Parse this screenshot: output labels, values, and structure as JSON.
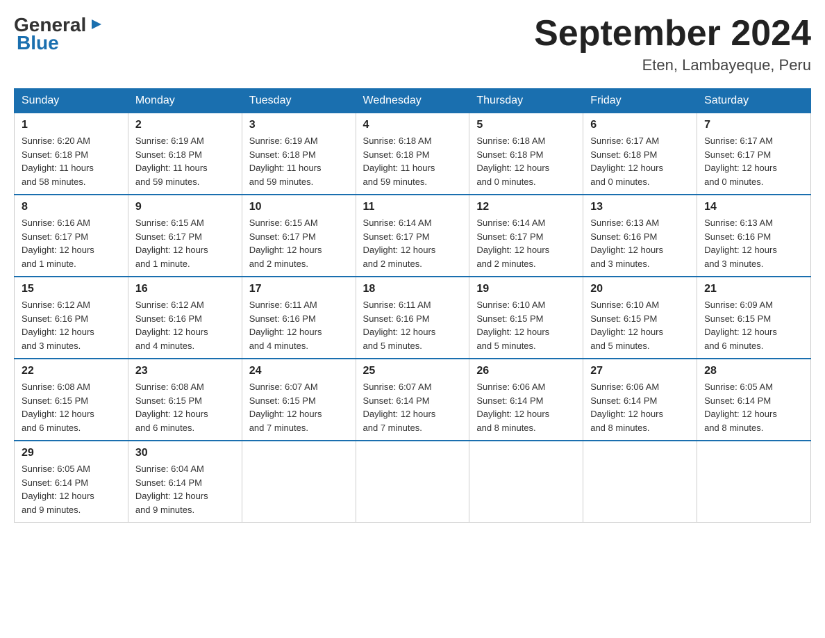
{
  "header": {
    "logo_general": "General",
    "logo_blue": "Blue",
    "month_year": "September 2024",
    "location": "Eten, Lambayeque, Peru"
  },
  "days_of_week": [
    "Sunday",
    "Monday",
    "Tuesday",
    "Wednesday",
    "Thursday",
    "Friday",
    "Saturday"
  ],
  "weeks": [
    [
      {
        "day": "1",
        "sunrise": "6:20 AM",
        "sunset": "6:18 PM",
        "daylight": "11 hours and 58 minutes."
      },
      {
        "day": "2",
        "sunrise": "6:19 AM",
        "sunset": "6:18 PM",
        "daylight": "11 hours and 59 minutes."
      },
      {
        "day": "3",
        "sunrise": "6:19 AM",
        "sunset": "6:18 PM",
        "daylight": "11 hours and 59 minutes."
      },
      {
        "day": "4",
        "sunrise": "6:18 AM",
        "sunset": "6:18 PM",
        "daylight": "11 hours and 59 minutes."
      },
      {
        "day": "5",
        "sunrise": "6:18 AM",
        "sunset": "6:18 PM",
        "daylight": "12 hours and 0 minutes."
      },
      {
        "day": "6",
        "sunrise": "6:17 AM",
        "sunset": "6:18 PM",
        "daylight": "12 hours and 0 minutes."
      },
      {
        "day": "7",
        "sunrise": "6:17 AM",
        "sunset": "6:17 PM",
        "daylight": "12 hours and 0 minutes."
      }
    ],
    [
      {
        "day": "8",
        "sunrise": "6:16 AM",
        "sunset": "6:17 PM",
        "daylight": "12 hours and 1 minute."
      },
      {
        "day": "9",
        "sunrise": "6:15 AM",
        "sunset": "6:17 PM",
        "daylight": "12 hours and 1 minute."
      },
      {
        "day": "10",
        "sunrise": "6:15 AM",
        "sunset": "6:17 PM",
        "daylight": "12 hours and 2 minutes."
      },
      {
        "day": "11",
        "sunrise": "6:14 AM",
        "sunset": "6:17 PM",
        "daylight": "12 hours and 2 minutes."
      },
      {
        "day": "12",
        "sunrise": "6:14 AM",
        "sunset": "6:17 PM",
        "daylight": "12 hours and 2 minutes."
      },
      {
        "day": "13",
        "sunrise": "6:13 AM",
        "sunset": "6:16 PM",
        "daylight": "12 hours and 3 minutes."
      },
      {
        "day": "14",
        "sunrise": "6:13 AM",
        "sunset": "6:16 PM",
        "daylight": "12 hours and 3 minutes."
      }
    ],
    [
      {
        "day": "15",
        "sunrise": "6:12 AM",
        "sunset": "6:16 PM",
        "daylight": "12 hours and 3 minutes."
      },
      {
        "day": "16",
        "sunrise": "6:12 AM",
        "sunset": "6:16 PM",
        "daylight": "12 hours and 4 minutes."
      },
      {
        "day": "17",
        "sunrise": "6:11 AM",
        "sunset": "6:16 PM",
        "daylight": "12 hours and 4 minutes."
      },
      {
        "day": "18",
        "sunrise": "6:11 AM",
        "sunset": "6:16 PM",
        "daylight": "12 hours and 5 minutes."
      },
      {
        "day": "19",
        "sunrise": "6:10 AM",
        "sunset": "6:15 PM",
        "daylight": "12 hours and 5 minutes."
      },
      {
        "day": "20",
        "sunrise": "6:10 AM",
        "sunset": "6:15 PM",
        "daylight": "12 hours and 5 minutes."
      },
      {
        "day": "21",
        "sunrise": "6:09 AM",
        "sunset": "6:15 PM",
        "daylight": "12 hours and 6 minutes."
      }
    ],
    [
      {
        "day": "22",
        "sunrise": "6:08 AM",
        "sunset": "6:15 PM",
        "daylight": "12 hours and 6 minutes."
      },
      {
        "day": "23",
        "sunrise": "6:08 AM",
        "sunset": "6:15 PM",
        "daylight": "12 hours and 6 minutes."
      },
      {
        "day": "24",
        "sunrise": "6:07 AM",
        "sunset": "6:15 PM",
        "daylight": "12 hours and 7 minutes."
      },
      {
        "day": "25",
        "sunrise": "6:07 AM",
        "sunset": "6:14 PM",
        "daylight": "12 hours and 7 minutes."
      },
      {
        "day": "26",
        "sunrise": "6:06 AM",
        "sunset": "6:14 PM",
        "daylight": "12 hours and 8 minutes."
      },
      {
        "day": "27",
        "sunrise": "6:06 AM",
        "sunset": "6:14 PM",
        "daylight": "12 hours and 8 minutes."
      },
      {
        "day": "28",
        "sunrise": "6:05 AM",
        "sunset": "6:14 PM",
        "daylight": "12 hours and 8 minutes."
      }
    ],
    [
      {
        "day": "29",
        "sunrise": "6:05 AM",
        "sunset": "6:14 PM",
        "daylight": "12 hours and 9 minutes."
      },
      {
        "day": "30",
        "sunrise": "6:04 AM",
        "sunset": "6:14 PM",
        "daylight": "12 hours and 9 minutes."
      },
      null,
      null,
      null,
      null,
      null
    ]
  ],
  "labels": {
    "sunrise": "Sunrise:",
    "sunset": "Sunset:",
    "daylight": "Daylight:"
  }
}
